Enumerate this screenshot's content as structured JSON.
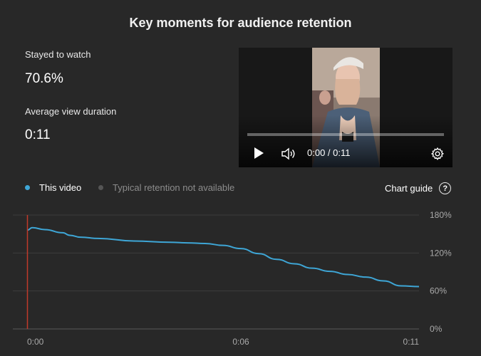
{
  "page": {
    "title": "Key moments for audience retention"
  },
  "metrics": {
    "stayed_label": "Stayed to watch",
    "stayed_value": "70.6%",
    "avg_label": "Average view duration",
    "avg_value": "0:11"
  },
  "player": {
    "time": "0:00 / 0:11",
    "progress": 0,
    "icons": [
      "play-icon",
      "volume-icon",
      "settings-gear-icon"
    ]
  },
  "legend": {
    "this_video": "This video",
    "typical": "Typical retention not available",
    "chart_guide": "Chart guide",
    "help_glyph": "?"
  },
  "colors": {
    "series": "#3ea6d6",
    "marker": "#c0392b",
    "inactive": "#555555"
  },
  "chart_data": {
    "type": "line",
    "title": "",
    "xlabel": "",
    "ylabel": "",
    "x_ticks": [
      "0:00",
      "0:06",
      "0:11"
    ],
    "y_ticks": [
      "180%",
      "120%",
      "60%",
      "0%"
    ],
    "ylim": [
      0,
      180
    ],
    "xlim": [
      0,
      11
    ],
    "grid": true,
    "legend_position": "top-left",
    "series": [
      {
        "name": "This video",
        "x": [
          0,
          0.15,
          0.5,
          1.0,
          1.2,
          1.5,
          2.0,
          3.0,
          4.0,
          4.5,
          5.0,
          5.5,
          6.0,
          6.5,
          7.0,
          7.5,
          8.0,
          8.5,
          9.0,
          9.5,
          10.0,
          10.5,
          11.0
        ],
        "values": [
          156,
          160,
          157,
          152,
          148,
          145,
          143,
          139,
          137,
          136,
          135,
          132,
          127,
          119,
          110,
          103,
          96,
          91,
          86,
          82,
          76,
          68,
          67
        ]
      }
    ]
  }
}
